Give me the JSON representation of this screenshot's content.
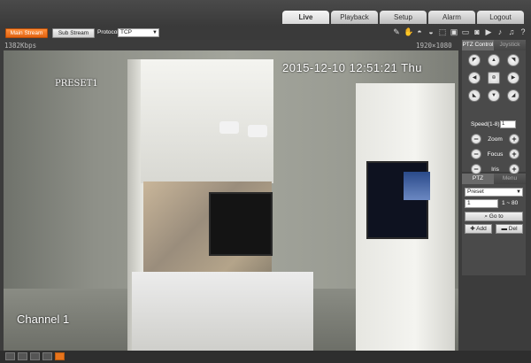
{
  "nav": {
    "tabs": [
      {
        "label": "Live",
        "active": true
      },
      {
        "label": "Playback",
        "active": false
      },
      {
        "label": "Setup",
        "active": false
      },
      {
        "label": "Alarm",
        "active": false
      },
      {
        "label": "Logout",
        "active": false
      }
    ]
  },
  "toolbar": {
    "main_stream": "Main Stream",
    "sub_stream": "Sub Stream",
    "protocol_label": "Protocol",
    "protocol_value": "TCP",
    "icons": [
      "pen-icon",
      "hand-icon",
      "dome-camera-icon",
      "dome-camera-alt-icon",
      "zoom-region-icon",
      "snapshot-icon",
      "capture-icon",
      "record-icon",
      "video-icon",
      "audio-icon",
      "microphone-icon",
      "help-icon"
    ]
  },
  "stream": {
    "bitrate": "1382Kbps",
    "resolution": "1920×1080"
  },
  "osd": {
    "preset": "PRESET1",
    "datetime": "2015-12-10 12:51:21 Thu",
    "channel": "Channel 1"
  },
  "ptz": {
    "tab_control": "PTZ Control",
    "tab_joystick": "Joystick",
    "speed_label": "Speed(1-8):",
    "speed_value": "1",
    "zoom_label": "Zoom",
    "focus_label": "Focus",
    "iris_label": "Iris",
    "minus": "−",
    "plus": "+"
  },
  "preset": {
    "tab_settings": "PTZ Settings",
    "tab_menu": "Menu",
    "type_value": "Preset",
    "number_value": "1",
    "range": "1 ~ 80",
    "goto_label": "Go to",
    "add_label": "Add",
    "del_label": "Del"
  },
  "colors": {
    "accent": "#e8741c",
    "background": "#3c3c3c"
  }
}
